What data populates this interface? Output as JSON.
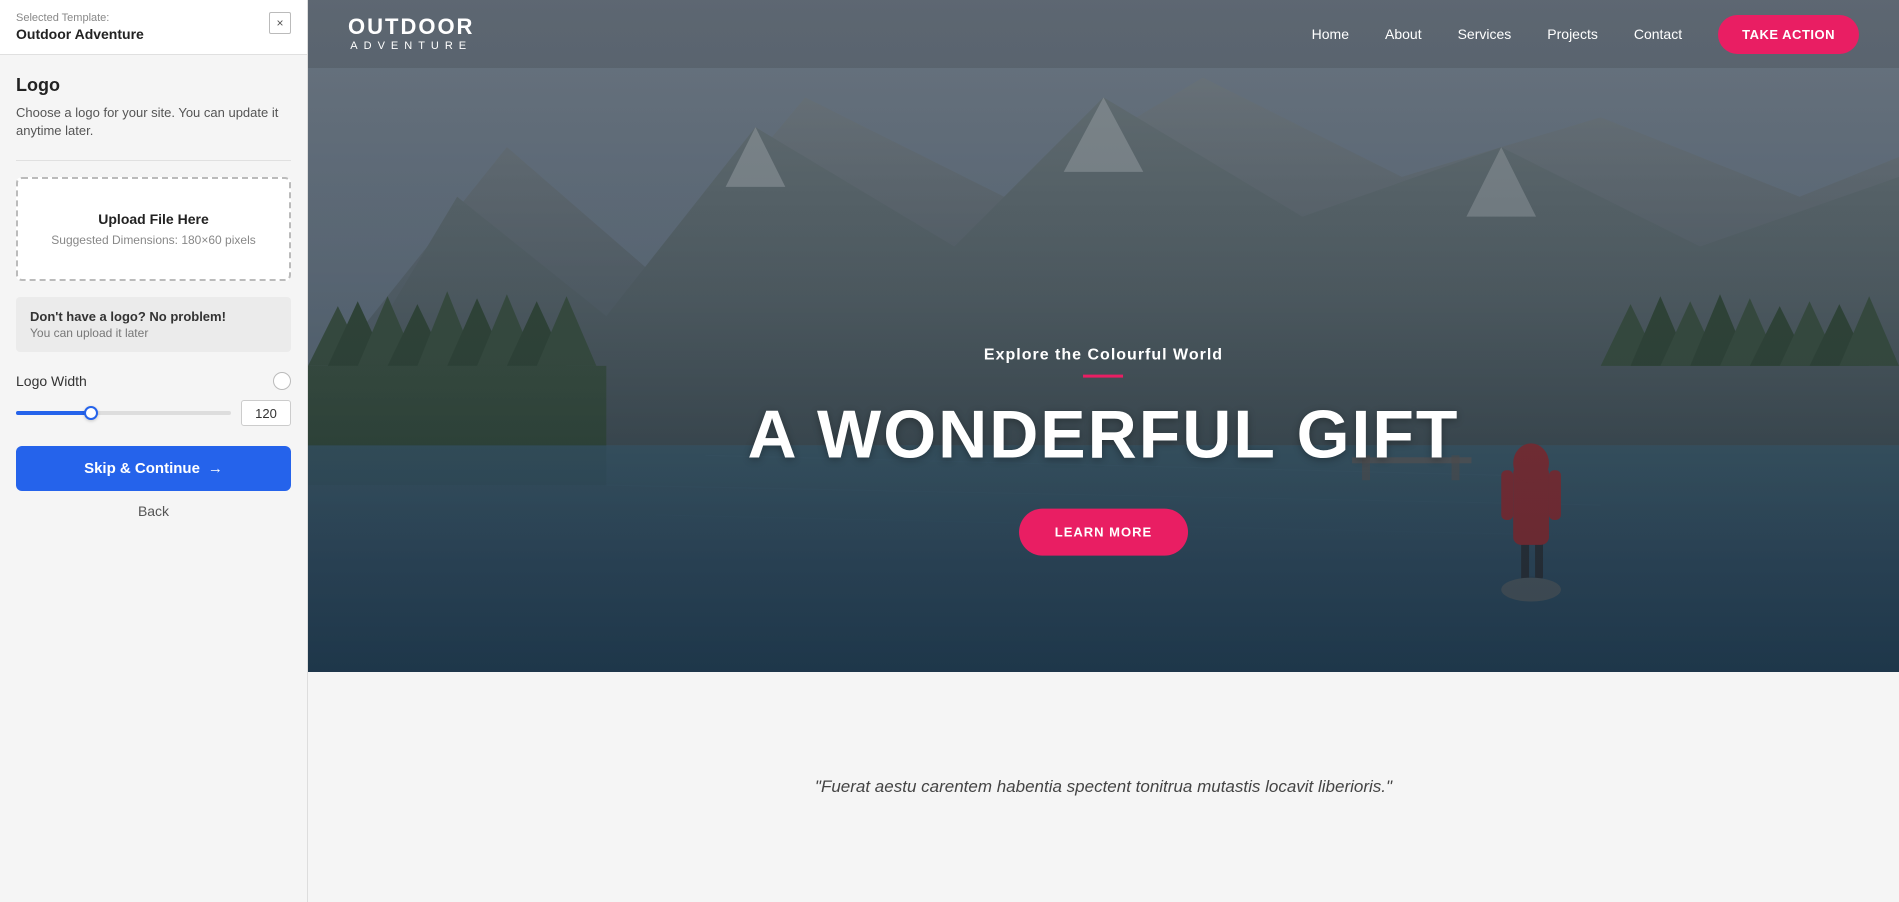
{
  "panel": {
    "selected_label": "Selected Template:",
    "template_name": "Outdoor Adventure",
    "close_icon": "×",
    "logo_section": {
      "title": "Logo",
      "description": "Choose a logo for your site. You can update it anytime later.",
      "upload_box": {
        "title": "Upload File Here",
        "subtitle": "Suggested Dimensions: 180×60 pixels"
      },
      "no_logo": {
        "title": "Don't have a logo? No problem!",
        "subtitle": "You can upload it later"
      },
      "logo_width": {
        "label": "Logo Width",
        "value": "120",
        "slider_percent": 35
      }
    },
    "skip_button": "Skip & Continue",
    "back_link": "Back",
    "collapse_icon": "‹"
  },
  "preview": {
    "navbar": {
      "brand_main": "OUTDOOR",
      "brand_sub": "ADVENTURE",
      "links": [
        {
          "label": "Home"
        },
        {
          "label": "About"
        },
        {
          "label": "Services"
        },
        {
          "label": "Projects"
        },
        {
          "label": "Contact"
        }
      ],
      "cta_button": "TAKE ACTION"
    },
    "hero": {
      "subtitle": "Explore the Colourful World",
      "title": "A WONDERFUL GIFT",
      "cta_button": "LEARN MORE"
    },
    "quote": {
      "text": "\"Fuerat aestu carentem habentia spectent tonitrua mutastis locavit liberioris.\""
    }
  }
}
